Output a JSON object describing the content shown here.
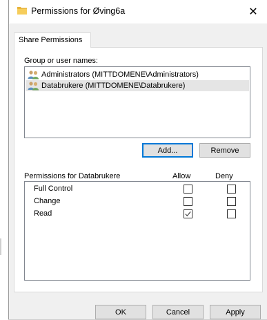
{
  "window": {
    "title": "Permissions for Øving6a",
    "close_glyph": "✕"
  },
  "tabs": [
    {
      "label": "Share Permissions",
      "active": true
    }
  ],
  "group_section": {
    "label": "Group or user names:",
    "items": [
      {
        "label": "Administrators (MITTDOMENE\\Administrators)",
        "icon": "users-group-icon",
        "selected": false
      },
      {
        "label": "Databrukere (MITTDOMENE\\Databrukere)",
        "icon": "users-group-icon",
        "selected": true
      }
    ],
    "add_label": "Add...",
    "remove_label": "Remove"
  },
  "permissions": {
    "header": "Permissions for Databrukere",
    "allow_label": "Allow",
    "deny_label": "Deny",
    "rows": [
      {
        "label": "Full Control",
        "allow": false,
        "deny": false
      },
      {
        "label": "Change",
        "allow": false,
        "deny": false
      },
      {
        "label": "Read",
        "allow": true,
        "deny": false
      }
    ]
  },
  "footer": {
    "ok_label": "OK",
    "cancel_label": "Cancel",
    "apply_label": "Apply"
  },
  "colors": {
    "dialog_bg": "#f0f0f0",
    "selection": "#e5e5e5",
    "focus_border": "#0078d7",
    "folder": "#e8b43a"
  }
}
